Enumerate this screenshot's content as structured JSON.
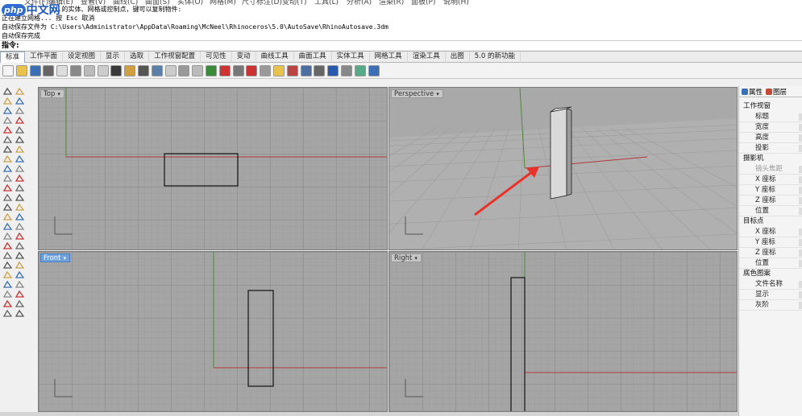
{
  "menu": [
    "文件(F)",
    "编辑(E)",
    "查看(V)",
    "曲线(C)",
    "曲面(S)",
    "实体(O)",
    "网格(M)",
    "尺寸标注(D)",
    "变动(T)",
    "工具(L)",
    "分析(A)",
    "渲染(R)",
    "面板(P)",
    "说明(H)"
  ],
  "logo": {
    "php": "php",
    "cn": "中文网"
  },
  "history": [
    "...的实体、网格或控制点，键可以复制物件:",
    "正在建立网格... 按 Esc 取消",
    "自动保存文件为 C:\\Users\\Administrator\\AppData\\Roaming\\McNeel\\Rhinoceros\\5.0\\AutoSave\\RhinoAutosave.3dm",
    "自动保存完成"
  ],
  "command_prompt": "指令:",
  "tabs": [
    "标准",
    "工作平面",
    "设定视图",
    "显示",
    "选取",
    "工作视窗配置",
    "可见性",
    "变动",
    "曲线工具",
    "曲面工具",
    "实体工具",
    "网格工具",
    "渲染工具",
    "出图",
    "5.0 的新功能"
  ],
  "active_tab": "标准",
  "viewports": {
    "top": "Top",
    "perspective": "Perspective",
    "front": "Front",
    "right": "Right"
  },
  "panel": {
    "tab_properties": "属性",
    "tab_layers": "图层",
    "sections": [
      {
        "title": "工作视窗",
        "rows": [
          "标题",
          "宽度",
          "高度",
          "投影"
        ]
      },
      {
        "title": "摄影机",
        "rows": [
          "镜头焦距",
          "X 座标",
          "Y 座标",
          "Z 座标",
          "位置"
        ]
      },
      {
        "title": "目标点",
        "rows": [
          "X 座标",
          "Y 座标",
          "Z 座标",
          "位置"
        ]
      },
      {
        "title": "底色图案",
        "rows": [
          "文件名称",
          "显示",
          "灰阶"
        ]
      }
    ]
  },
  "colors": {
    "viewport_bg": "#a5a5a5",
    "x_axis": "#b23a3a",
    "y_axis": "#4e8a3a",
    "active_label": "#6fa0dc",
    "arrow": "#e8322a"
  }
}
